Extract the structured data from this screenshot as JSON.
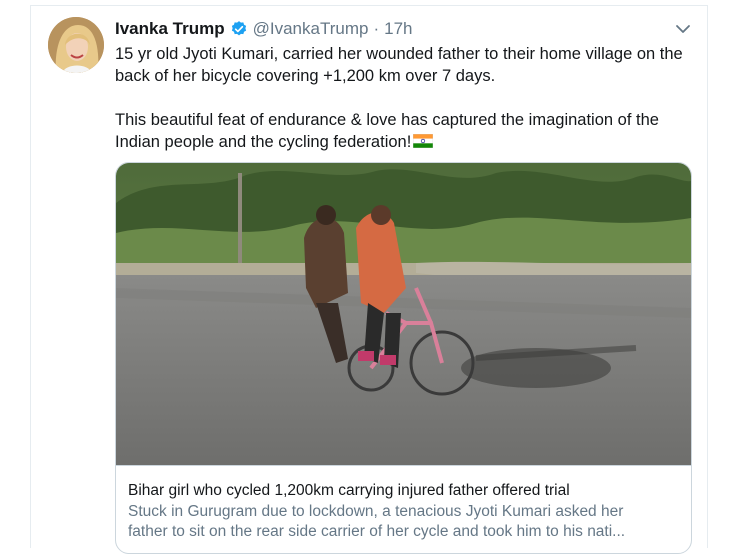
{
  "tweet": {
    "author_name": "Ivanka Trump",
    "handle": "@IvankaTrump",
    "separator": "·",
    "timestamp": "17h",
    "text_paragraph_1": "15 yr old Jyoti Kumari, carried her wounded father to their home village on the back of her bicycle covering +1,200 km over 7 days.",
    "text_paragraph_2": "This beautiful feat of endurance & love has captured the imagination of the Indian people and the cycling federation!",
    "card": {
      "title": "Bihar girl who cycled 1,200km carrying injured father offered trial",
      "description_line_1": "Stuck in Gurugram due to lockdown, a tenacious Jyoti Kumari asked her",
      "description_line_2": "father to sit on the rear side carrier of her cycle and took him to his nati..."
    }
  },
  "icons": {
    "verified": "verified-badge-icon",
    "caret": "chevron-down-icon",
    "flag": "india-flag-emoji"
  },
  "colors": {
    "verified_blue": "#1da1f2",
    "muted_text": "#657786",
    "main_text": "#14171a",
    "border": "#ccd6dd"
  }
}
